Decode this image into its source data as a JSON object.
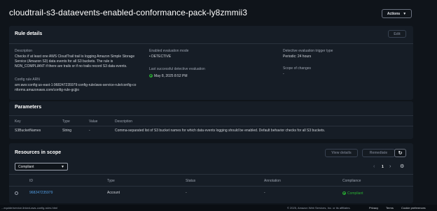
{
  "header": {
    "title": "cloudtrail-s3-dataevents-enabled-conformance-pack-ly8zmmii3",
    "actions_label": "Actions"
  },
  "rule_details": {
    "title": "Rule details",
    "edit_label": "Edit",
    "description_label": "Description",
    "description": "Checks if at least one AWS CloudTrail trail is logging Amazon Simple Storage Service (Amazon S3) data events for all S3 buckets. The rule is NON_COMPLIANT if there are trails or if no trails record S3 data events.",
    "arn_label": "Config rule ARN",
    "arn": "arn:aws:config:us-east-1:968247235979:config-rule/aws-service-rule/config-conforms.amazonaws.com/config-rule-gcjjio",
    "eval_mode_label": "Enabled evaluation mode",
    "eval_mode": "DETECTIVE",
    "last_eval_label": "Last successful detective evaluation",
    "last_eval": "May 8, 2025 8:52 PM",
    "trigger_label": "Detective evaluation trigger type",
    "trigger": "Periodic: 24 hours",
    "scope_label": "Scope of changes",
    "scope": "-"
  },
  "parameters": {
    "title": "Parameters",
    "columns": [
      "Key",
      "Type",
      "Value",
      "Description"
    ],
    "row": {
      "key": "S3BucketNames",
      "type": "String",
      "value": "-",
      "description": "Comma-separated list of S3 bucket names for which data events logging should be enabled. Default behavior checks for all S3 buckets."
    }
  },
  "resources": {
    "title": "Resources in scope",
    "view_details_label": "View details",
    "remediate_label": "Remediate",
    "filter_value": "Compliant",
    "page": "1",
    "columns": [
      "ID",
      "Type",
      "Status",
      "Annotation",
      "Compliance"
    ],
    "row": {
      "id": "968247235979",
      "type": "Account",
      "status": "-",
      "annotation": "-",
      "compliance": "Compliant"
    }
  },
  "footer": {
    "url": "...equide/service-linked-aws-config-rules.html",
    "copyright": "© 2025, Amazon Web Services, Inc. or its affiliates.",
    "privacy": "Privacy",
    "terms": "Terms",
    "cookies": "Cookie preferences"
  },
  "colors": {
    "link": "#539fe5",
    "success": "#29ad32",
    "panel": "#161d26"
  }
}
